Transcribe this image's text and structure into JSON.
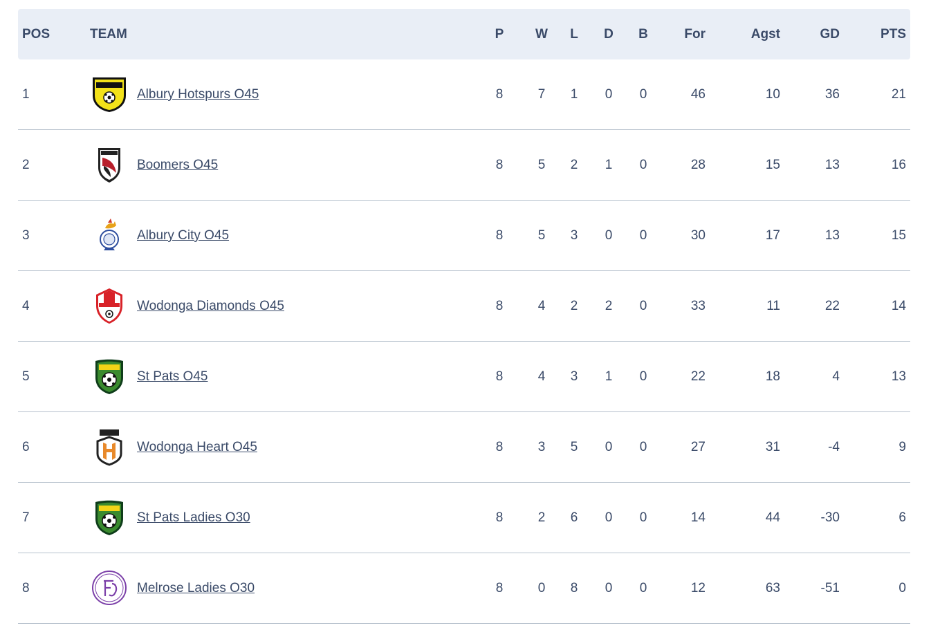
{
  "columns": {
    "pos": "POS",
    "team": "TEAM",
    "p": "P",
    "w": "W",
    "l": "L",
    "d": "D",
    "b": "B",
    "for": "For",
    "agst": "Agst",
    "gd": "GD",
    "pts": "PTS"
  },
  "rows": [
    {
      "pos": "1",
      "team": "Albury Hotspurs O45",
      "p": "8",
      "w": "7",
      "l": "1",
      "d": "0",
      "b": "0",
      "for": "46",
      "agst": "10",
      "gd": "36",
      "pts": "21",
      "logo": "albury-hotspurs-logo-icon"
    },
    {
      "pos": "2",
      "team": "Boomers O45",
      "p": "8",
      "w": "5",
      "l": "2",
      "d": "1",
      "b": "0",
      "for": "28",
      "agst": "15",
      "gd": "13",
      "pts": "16",
      "logo": "boomers-logo-icon"
    },
    {
      "pos": "3",
      "team": "Albury City O45",
      "p": "8",
      "w": "5",
      "l": "3",
      "d": "0",
      "b": "0",
      "for": "30",
      "agst": "17",
      "gd": "13",
      "pts": "15",
      "logo": "albury-city-logo-icon"
    },
    {
      "pos": "4",
      "team": "Wodonga Diamonds O45",
      "p": "8",
      "w": "4",
      "l": "2",
      "d": "2",
      "b": "0",
      "for": "33",
      "agst": "11",
      "gd": "22",
      "pts": "14",
      "logo": "wodonga-diamonds-logo-icon"
    },
    {
      "pos": "5",
      "team": "St Pats O45",
      "p": "8",
      "w": "4",
      "l": "3",
      "d": "1",
      "b": "0",
      "for": "22",
      "agst": "18",
      "gd": "4",
      "pts": "13",
      "logo": "st-pats-logo-icon"
    },
    {
      "pos": "6",
      "team": "Wodonga Heart O45",
      "p": "8",
      "w": "3",
      "l": "5",
      "d": "0",
      "b": "0",
      "for": "27",
      "agst": "31",
      "gd": "-4",
      "pts": "9",
      "logo": "wodonga-heart-logo-icon"
    },
    {
      "pos": "7",
      "team": "St Pats Ladies O30",
      "p": "8",
      "w": "2",
      "l": "6",
      "d": "0",
      "b": "0",
      "for": "14",
      "agst": "44",
      "gd": "-30",
      "pts": "6",
      "logo": "st-pats-logo-icon"
    },
    {
      "pos": "8",
      "team": "Melrose Ladies O30",
      "p": "8",
      "w": "0",
      "l": "8",
      "d": "0",
      "b": "0",
      "for": "12",
      "agst": "63",
      "gd": "-51",
      "pts": "0",
      "logo": "melrose-logo-icon"
    }
  ],
  "colors": {
    "header_bg": "#e9eef6",
    "text": "#3a4a68",
    "divider": "#b5c0cc"
  }
}
